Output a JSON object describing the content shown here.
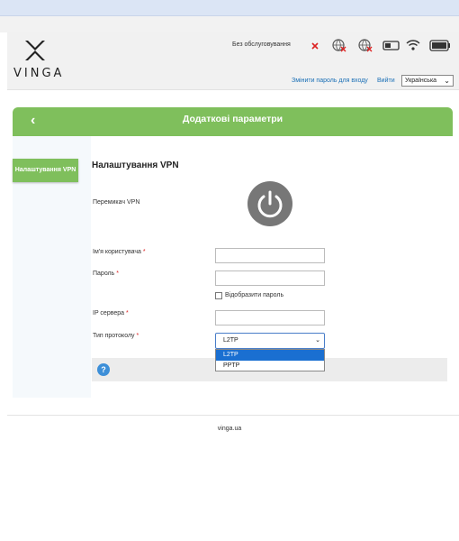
{
  "header": {
    "brand": "VINGA",
    "service_status": "Без обслуговування",
    "change_password": "Змінити пароль для входу",
    "logout": "Вийти",
    "language": "Українська"
  },
  "page": {
    "title": "Додаткові параметри",
    "back_icon": "chevron-left-icon"
  },
  "sidebar": {
    "items": [
      {
        "label": "Налаштування VPN"
      }
    ]
  },
  "vpn": {
    "section_title": "Налаштування VPN",
    "switch_label": "Перемикач VPN",
    "username_label": "Ім'я користувача",
    "password_label": "Пароль",
    "show_password_label": "Відобразити пароль",
    "server_ip_label": "IP сервера",
    "protocol_label": "Тип протоколу",
    "required_mark": "*",
    "protocol_selected": "L2TP",
    "protocol_options": [
      "L2TP",
      "PPTP"
    ]
  },
  "help": {
    "icon": "?"
  },
  "footer": {
    "text": "vinga.ua"
  },
  "colors": {
    "accent": "#7fbf5c",
    "link": "#1a6fb6",
    "selected_option": "#1a6fd1",
    "error": "#d22222"
  }
}
